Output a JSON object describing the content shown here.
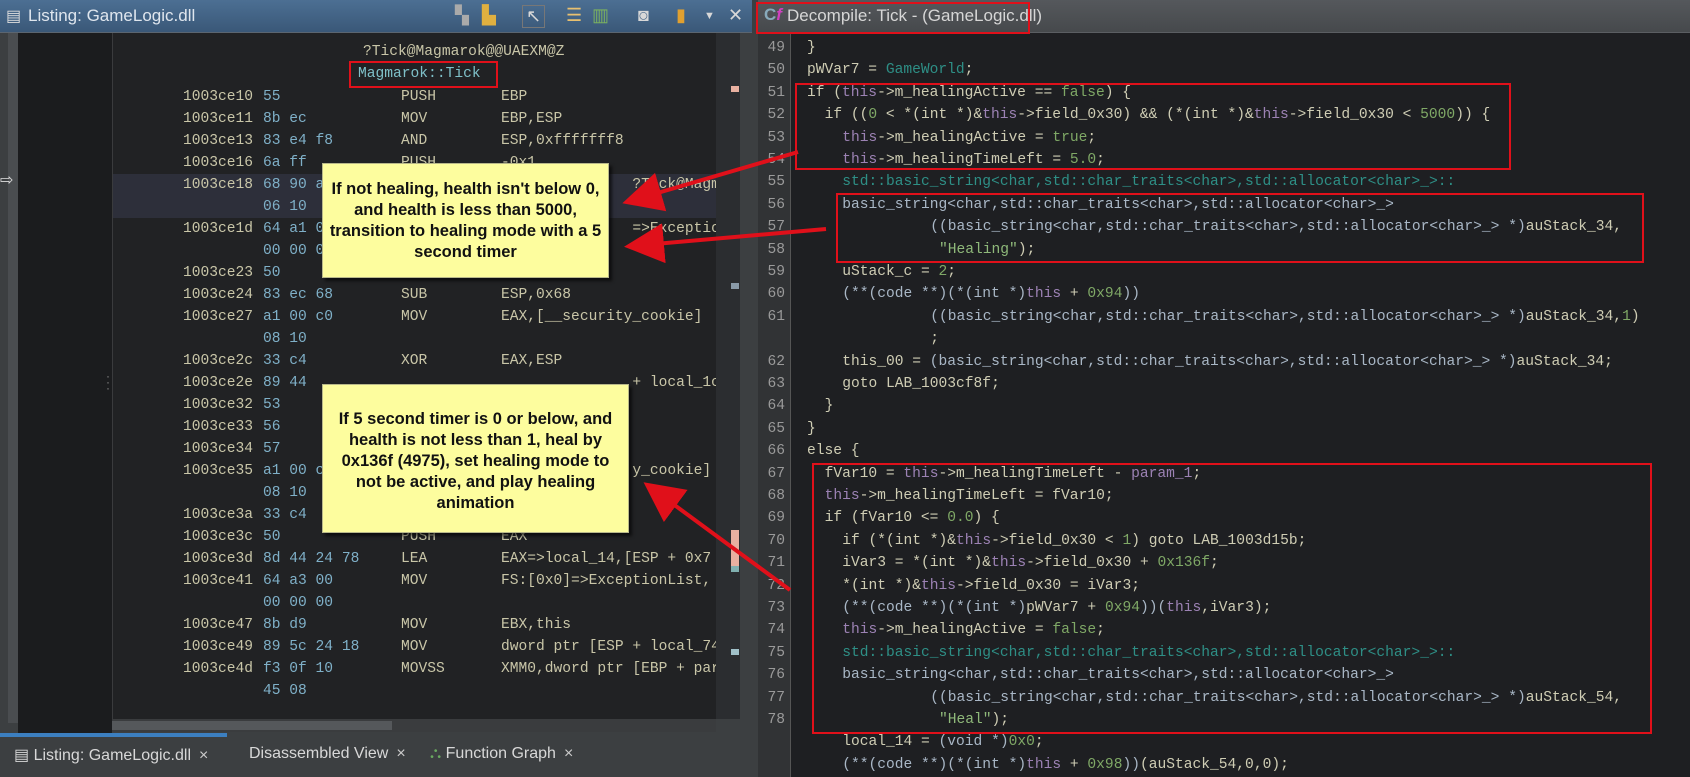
{
  "listing_panel": {
    "title": "Listing:  GameLogic.dll",
    "toolbar_icons": [
      "copy-icon",
      "paste-icon",
      "cursor-select-icon",
      "field-layout-icon",
      "diff-icon",
      "snapshot-icon",
      "panel-options-icon",
      "dropdown-icon",
      "close-icon"
    ],
    "mangled_name": "?Tick@Magmarok@@UAEXM@Z",
    "function_label": "Magmarok::Tick",
    "rows": [
      {
        "addr": "1003ce10",
        "bytes": "55",
        "mn": "PUSH",
        "op": "EBP"
      },
      {
        "addr": "1003ce11",
        "bytes": "8b ec",
        "mn": "MOV",
        "op": "EBP,ESP"
      },
      {
        "addr": "1003ce13",
        "bytes": "83 e4 f8",
        "mn": "AND",
        "op": "ESP,0xfffffff8"
      },
      {
        "addr": "1003ce16",
        "bytes": "6a ff",
        "mn": "PUSH",
        "op": "-0x1"
      },
      {
        "addr": "1003ce18",
        "bytes": "68 90 a",
        "mn": "",
        "op": "               ?Tick@Magmar",
        "highlight": true
      },
      {
        "addr": "",
        "bytes": "06 10",
        "mn": "",
        "op": ""
      },
      {
        "addr": "1003ce1d",
        "bytes": "64 a1 0",
        "mn": "",
        "op": "               =>ExceptionL"
      },
      {
        "addr": "",
        "bytes": "00 00 0",
        "mn": "",
        "op": ""
      },
      {
        "addr": "1003ce23",
        "bytes": "50",
        "mn": "PUSH",
        "op": "EAX"
      },
      {
        "addr": "1003ce24",
        "bytes": "83 ec 68",
        "mn": "SUB",
        "op": "ESP,0x68"
      },
      {
        "addr": "1003ce27",
        "bytes": "a1 00 c0",
        "mn": "MOV",
        "op": "EAX,[__security_cookie]"
      },
      {
        "addr": "",
        "bytes": "08 10",
        "mn": "",
        "op": ""
      },
      {
        "addr": "1003ce2c",
        "bytes": "33 c4",
        "mn": "XOR",
        "op": "EAX,ESP"
      },
      {
        "addr": "1003ce2e",
        "bytes": "89 44",
        "mn": "",
        "op": "               + local_1c"
      },
      {
        "addr": "1003ce32",
        "bytes": "53",
        "mn": "",
        "op": ""
      },
      {
        "addr": "1003ce33",
        "bytes": "56",
        "mn": "",
        "op": ""
      },
      {
        "addr": "1003ce34",
        "bytes": "57",
        "mn": "",
        "op": ""
      },
      {
        "addr": "1003ce35",
        "bytes": "a1 00 c",
        "mn": "",
        "op": "               y_cookie]"
      },
      {
        "addr": "",
        "bytes": "08 10",
        "mn": "",
        "op": ""
      },
      {
        "addr": "1003ce3a",
        "bytes": "33 c4",
        "mn": "",
        "op": ""
      },
      {
        "addr": "1003ce3c",
        "bytes": "50",
        "mn": "PUSH",
        "op": "EAX"
      },
      {
        "addr": "1003ce3d",
        "bytes": "8d 44 24 78",
        "mn": "LEA",
        "op": "EAX=>local_14,[ESP + 0x7"
      },
      {
        "addr": "1003ce41",
        "bytes": "64 a3 00",
        "mn": "MOV",
        "op": "FS:[0x0]=>ExceptionList,"
      },
      {
        "addr": "",
        "bytes": "00 00 00",
        "mn": "",
        "op": ""
      },
      {
        "addr": "1003ce47",
        "bytes": "8b d9",
        "mn": "MOV",
        "op": "EBX,this"
      },
      {
        "addr": "1003ce49",
        "bytes": "89 5c 24 18",
        "mn": "MOV",
        "op": "dword ptr [ESP + local_74"
      },
      {
        "addr": "1003ce4d",
        "bytes": "f3 0f 10",
        "mn": "MOVSS",
        "op": "XMM0,dword ptr [EBP + par"
      },
      {
        "addr": "",
        "bytes": "45 08",
        "mn": "",
        "op": ""
      }
    ]
  },
  "bottom_tabs": [
    {
      "label": "Listing:  GameLogic.dll",
      "icon": "listing-icon",
      "close": "×"
    },
    {
      "label": "Disassembled View",
      "close": "×"
    },
    {
      "label": "Function Graph",
      "icon": "function-graph-icon",
      "close": "×"
    }
  ],
  "decompile_panel": {
    "title": "Decompile: Tick -  (GameLogic.dll)",
    "icon": "decompiler-icon",
    "lines": [
      {
        "n": "49",
        "i": 0,
        "t": [
          [
            "d",
            "}"
          ]
        ]
      },
      {
        "n": "50",
        "i": 0,
        "t": [
          [
            "d",
            "pWVar7 = "
          ],
          [
            "t",
            "GameWorld"
          ],
          [
            "d",
            ";"
          ]
        ]
      },
      {
        "n": "51",
        "i": 0,
        "t": [
          [
            "d",
            "if ("
          ],
          [
            "k",
            "this"
          ],
          [
            "d",
            "->m_healingActive == "
          ],
          [
            "n",
            "false"
          ],
          [
            "d",
            ") {"
          ]
        ]
      },
      {
        "n": "52",
        "i": 2,
        "t": [
          [
            "d",
            "if (("
          ],
          [
            "n",
            "0"
          ],
          [
            "d",
            " < *(int *)&"
          ],
          [
            "k",
            "this"
          ],
          [
            "d",
            "->field_0x30) && (*(int *)&"
          ],
          [
            "k",
            "this"
          ],
          [
            "d",
            "->field_0x30 < "
          ],
          [
            "n",
            "5000"
          ],
          [
            "d",
            ")) {"
          ]
        ]
      },
      {
        "n": "53",
        "i": 4,
        "t": [
          [
            "k",
            "this"
          ],
          [
            "d",
            "->m_healingActive = "
          ],
          [
            "n",
            "true"
          ],
          [
            "d",
            ";"
          ]
        ]
      },
      {
        "n": "54",
        "i": 4,
        "t": [
          [
            "k",
            "this"
          ],
          [
            "d",
            "->m_healingTimeLeft = "
          ],
          [
            "n",
            "5.0"
          ],
          [
            "d",
            ";"
          ]
        ]
      },
      {
        "n": "55",
        "i": 4,
        "t": [
          [
            "t",
            "std::basic_string<char,std::char_traits<char>,std::allocator<char>_>::"
          ]
        ]
      },
      {
        "n": "56",
        "i": 4,
        "t": [
          [
            "f",
            "basic_string<char,std::char_traits<char>,std::allocator<char>_>"
          ]
        ]
      },
      {
        "n": "57",
        "i": 14,
        "t": [
          [
            "f",
            "((basic_string<char,std::char_traits<char>,std::allocator<char>_> *)"
          ],
          [
            "d",
            "auStack_34,"
          ]
        ]
      },
      {
        "n": "58",
        "i": 15,
        "t": [
          [
            "s",
            "\"Healing\""
          ],
          [
            "d",
            ");"
          ]
        ]
      },
      {
        "n": "59",
        "i": 4,
        "t": [
          [
            "d",
            "uStack_c = "
          ],
          [
            "n",
            "2"
          ],
          [
            "d",
            ";"
          ]
        ]
      },
      {
        "n": "60",
        "i": 4,
        "t": [
          [
            "f",
            "(**(code **)(*(int *)"
          ],
          [
            "k",
            "this"
          ],
          [
            "d",
            " + "
          ],
          [
            "n",
            "0x94"
          ],
          [
            "f",
            "))"
          ]
        ]
      },
      {
        "n": "61",
        "i": 14,
        "t": [
          [
            "f",
            "((basic_string<char,std::char_traits<char>,std::allocator<char>_> *)"
          ],
          [
            "d",
            "auStack_34,"
          ],
          [
            "n",
            "1"
          ],
          [
            "d",
            ")"
          ]
        ]
      },
      {
        "n": "",
        "i": 14,
        "t": [
          [
            "d",
            ";"
          ]
        ]
      },
      {
        "n": "62",
        "i": 4,
        "t": [
          [
            "d",
            "this_00 = "
          ],
          [
            "f",
            "(basic_string<char,std::char_traits<char>,std::allocator<char>_> *)"
          ],
          [
            "d",
            "auStack_34;"
          ]
        ]
      },
      {
        "n": "63",
        "i": 4,
        "t": [
          [
            "d",
            "goto LAB_1003cf8f;"
          ]
        ]
      },
      {
        "n": "64",
        "i": 2,
        "t": [
          [
            "d",
            "}"
          ]
        ]
      },
      {
        "n": "65",
        "i": 0,
        "t": [
          [
            "d",
            "}"
          ]
        ]
      },
      {
        "n": "66",
        "i": 0,
        "t": [
          [
            "d",
            "else {"
          ]
        ]
      },
      {
        "n": "67",
        "i": 2,
        "t": [
          [
            "d",
            "fVar10 = "
          ],
          [
            "k",
            "this"
          ],
          [
            "d",
            "->m_healingTimeLeft - "
          ],
          [
            "k",
            "param_1"
          ],
          [
            "d",
            ";"
          ]
        ]
      },
      {
        "n": "68",
        "i": 2,
        "t": [
          [
            "k",
            "this"
          ],
          [
            "d",
            "->m_healingTimeLeft = fVar10;"
          ]
        ]
      },
      {
        "n": "69",
        "i": 2,
        "t": [
          [
            "d",
            "if (fVar10 <= "
          ],
          [
            "n",
            "0.0"
          ],
          [
            "d",
            ") {"
          ]
        ]
      },
      {
        "n": "70",
        "i": 4,
        "t": [
          [
            "d",
            "if (*(int *)&"
          ],
          [
            "k",
            "this"
          ],
          [
            "d",
            "->field_0x30 < "
          ],
          [
            "n",
            "1"
          ],
          [
            "d",
            ") goto LAB_1003d15b;"
          ]
        ]
      },
      {
        "n": "71",
        "i": 4,
        "t": [
          [
            "d",
            "iVar3 = *(int *)&"
          ],
          [
            "k",
            "this"
          ],
          [
            "d",
            "->field_0x30 + "
          ],
          [
            "n",
            "0x136f"
          ],
          [
            "d",
            ";"
          ]
        ]
      },
      {
        "n": "72",
        "i": 4,
        "t": [
          [
            "d",
            "*(int *)&"
          ],
          [
            "k",
            "this"
          ],
          [
            "d",
            "->field_0x30 = iVar3;"
          ]
        ]
      },
      {
        "n": "73",
        "i": 4,
        "t": [
          [
            "f",
            "(**(code **)(*(int *)"
          ],
          [
            "d",
            "pWVar7 + "
          ],
          [
            "n",
            "0x94"
          ],
          [
            "f",
            "))("
          ],
          [
            "k",
            "this"
          ],
          [
            "d",
            ",iVar3);"
          ]
        ]
      },
      {
        "n": "74",
        "i": 4,
        "t": [
          [
            "k",
            "this"
          ],
          [
            "d",
            "->m_healingActive = "
          ],
          [
            "n",
            "false"
          ],
          [
            "d",
            ";"
          ]
        ]
      },
      {
        "n": "75",
        "i": 4,
        "t": [
          [
            "t",
            "std::basic_string<char,std::char_traits<char>,std::allocator<char>_>::"
          ]
        ]
      },
      {
        "n": "76",
        "i": 4,
        "t": [
          [
            "f",
            "basic_string<char,std::char_traits<char>,std::allocator<char>_>"
          ]
        ]
      },
      {
        "n": "77",
        "i": 14,
        "t": [
          [
            "f",
            "((basic_string<char,std::char_traits<char>,std::allocator<char>_> *)"
          ],
          [
            "d",
            "auStack_54,"
          ]
        ]
      },
      {
        "n": "78",
        "i": 15,
        "t": [
          [
            "s",
            "\"Heal\""
          ],
          [
            "d",
            ");"
          ]
        ]
      },
      {
        "n": "",
        "i": 4,
        "t": [
          [
            "d",
            "local_14 = "
          ],
          [
            "f",
            "(void *)"
          ],
          [
            "n",
            "0x0"
          ],
          [
            "d",
            ";"
          ]
        ]
      },
      {
        "n": "",
        "i": 4,
        "t": [
          [
            "f",
            "(**(code **)(*(int *)"
          ],
          [
            "k",
            "this"
          ],
          [
            "d",
            " + "
          ],
          [
            "n",
            "0x98"
          ],
          [
            "f",
            "))"
          ],
          [
            "d",
            "(auStack_54,0,0);"
          ]
        ]
      }
    ]
  },
  "annotations": {
    "callout_1": "If not healing, health isn't below 0, and health is less than 5000, transition to healing mode with a 5 second timer",
    "callout_2": "If 5 second timer is 0 or below, and health is not less than 1, heal by 0x136f (4975), set healing mode to not be active, and play healing animation",
    "highlight_color": "#e0101a",
    "callout_color": "#fdfd9e"
  }
}
